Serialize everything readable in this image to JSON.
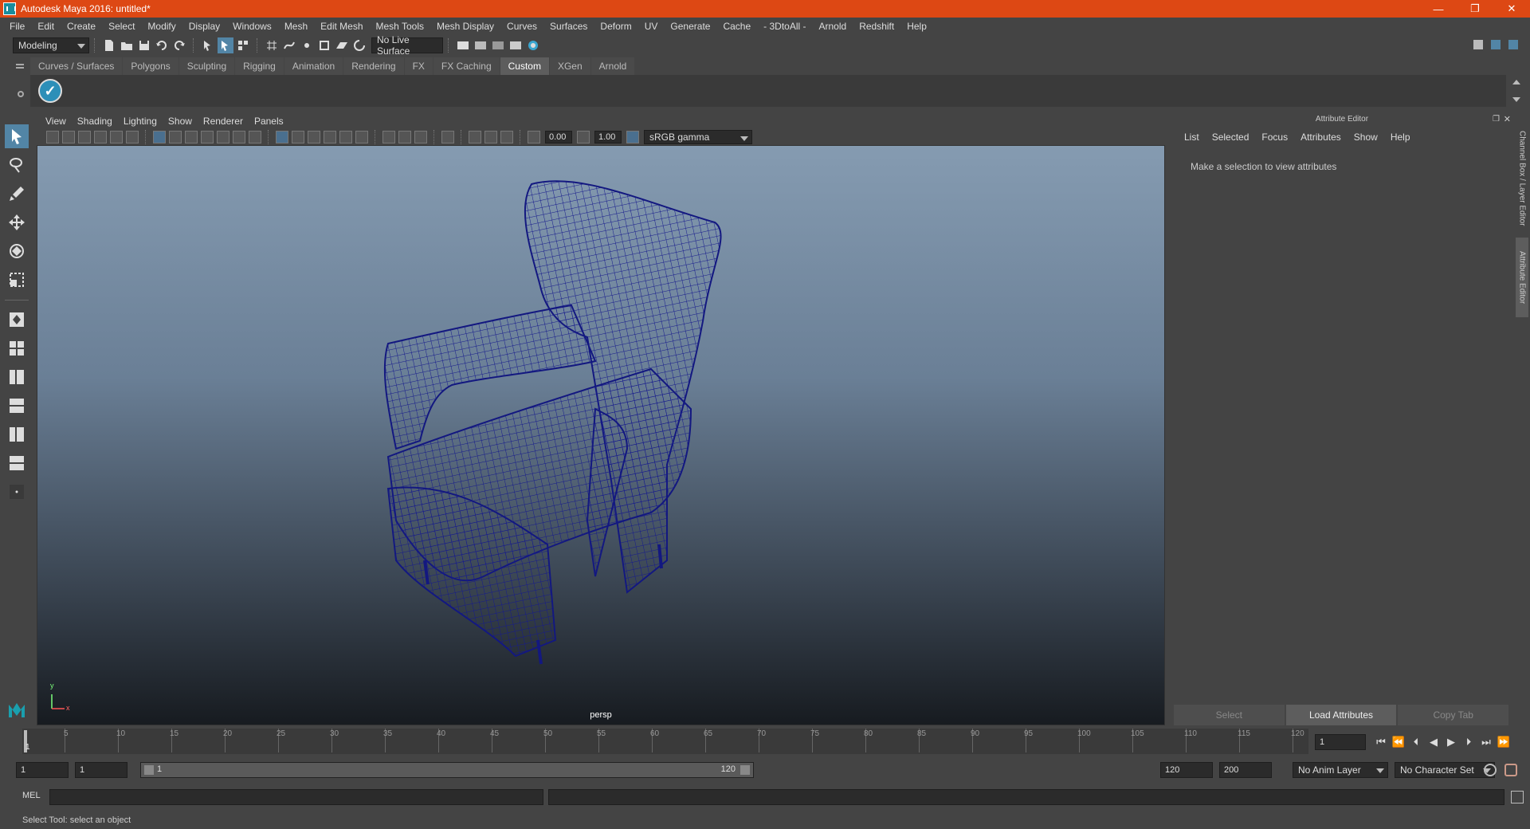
{
  "titlebar": {
    "title": "Autodesk Maya 2016: untitled*",
    "min": "—",
    "max": "❐",
    "close": "✕"
  },
  "menus": [
    "File",
    "Edit",
    "Create",
    "Select",
    "Modify",
    "Display",
    "Windows",
    "Mesh",
    "Edit Mesh",
    "Mesh Tools",
    "Mesh Display",
    "Curves",
    "Surfaces",
    "Deform",
    "UV",
    "Generate",
    "Cache",
    "- 3DtoAll -",
    "Arnold",
    "Redshift",
    "Help"
  ],
  "toolbar": {
    "mode": "Modeling",
    "live_surface": "No Live Surface"
  },
  "shelf_tabs": [
    "Curves / Surfaces",
    "Polygons",
    "Sculpting",
    "Rigging",
    "Animation",
    "Rendering",
    "FX",
    "FX Caching",
    "Custom",
    "XGen",
    "Arnold"
  ],
  "shelf_active": "Custom",
  "viewport": {
    "menus": [
      "View",
      "Shading",
      "Lighting",
      "Show",
      "Renderer",
      "Panels"
    ],
    "exposure": "0.00",
    "gamma": "1.00",
    "color_space": "sRGB gamma",
    "camera": "persp",
    "axis_y": "y",
    "axis_x": "x"
  },
  "attribute_editor": {
    "title": "Attribute Editor",
    "menus": [
      "List",
      "Selected",
      "Focus",
      "Attributes",
      "Show",
      "Help"
    ],
    "message": "Make a selection to view attributes",
    "buttons": {
      "select": "Select",
      "load": "Load Attributes",
      "copy": "Copy Tab"
    }
  },
  "side_tabs": {
    "channel_box": "Channel Box / Layer Editor",
    "attr": "Attribute Editor"
  },
  "timeline": {
    "ticks": [
      "5",
      "10",
      "15",
      "20",
      "25",
      "30",
      "35",
      "40",
      "45",
      "50",
      "55",
      "60",
      "65",
      "70",
      "75",
      "80",
      "85",
      "90",
      "95",
      "100",
      "105",
      "110",
      "115",
      "120"
    ],
    "current_frame": "1",
    "current_field": "1"
  },
  "range": {
    "start": "1",
    "inner_start": "1",
    "slider_start": "1",
    "slider_end": "120",
    "end": "120",
    "total_end": "200",
    "anim_layer": "No Anim Layer",
    "char_set": "No Character Set"
  },
  "command": {
    "label": "MEL"
  },
  "status": {
    "text": "Select Tool: select an object"
  }
}
